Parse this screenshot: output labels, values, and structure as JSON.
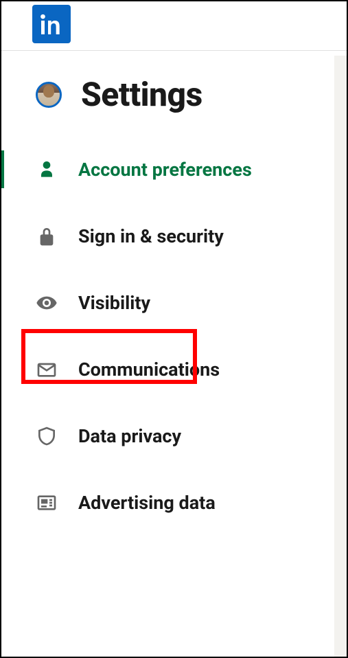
{
  "header": {
    "logo_label": "in"
  },
  "page": {
    "title": "Settings"
  },
  "menu": {
    "items": [
      {
        "id": "account-preferences",
        "label": "Account preferences",
        "icon": "person-icon",
        "active": true
      },
      {
        "id": "sign-in-security",
        "label": "Sign in & security",
        "icon": "lock-icon",
        "active": false
      },
      {
        "id": "visibility",
        "label": "Visibility",
        "icon": "eye-icon",
        "active": false,
        "highlighted": true
      },
      {
        "id": "communications",
        "label": "Communications",
        "icon": "envelope-icon",
        "active": false
      },
      {
        "id": "data-privacy",
        "label": "Data privacy",
        "icon": "shield-icon",
        "active": false
      },
      {
        "id": "advertising-data",
        "label": "Advertising data",
        "icon": "newspaper-icon",
        "active": false
      }
    ]
  },
  "highlight": {
    "target": "visibility"
  }
}
